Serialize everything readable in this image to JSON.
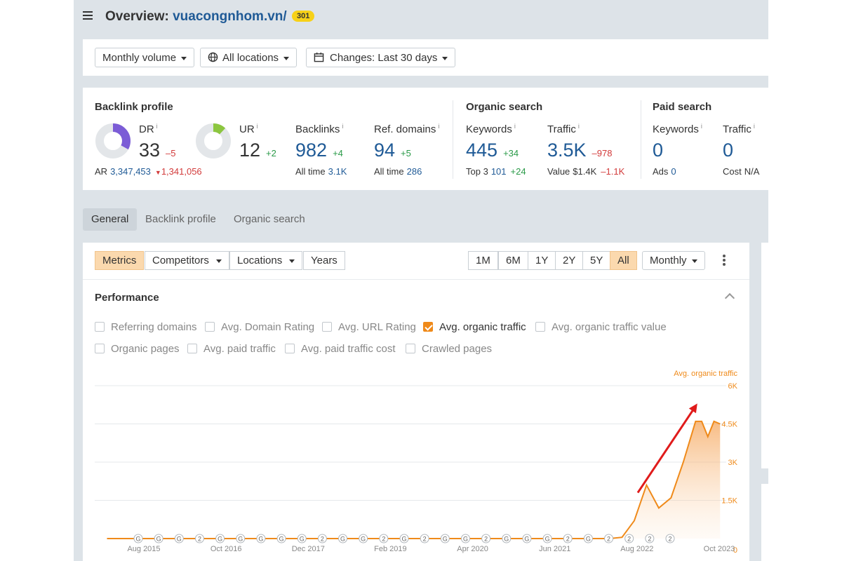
{
  "header": {
    "title_prefix": "Overview:",
    "domain": "vuacongnhom.vn/",
    "badge": "301"
  },
  "filters": {
    "volume": "Monthly volume",
    "locations": "All locations",
    "changes": "Changes: Last 30 days"
  },
  "backlink_profile": {
    "heading": "Backlink profile",
    "dr": {
      "label": "DR",
      "value": "33",
      "delta": "–5",
      "ring_fraction": 0.33,
      "ring_color": "#7b5cd6"
    },
    "ur": {
      "label": "UR",
      "value": "12",
      "delta": "+2",
      "ring_fraction": 0.12,
      "ring_color": "#8cc63f"
    },
    "ar": {
      "label": "AR",
      "value": "3,347,453",
      "delta": "1,341,056"
    },
    "backlinks": {
      "label": "Backlinks",
      "value": "982",
      "delta": "+4",
      "sub_label": "All time",
      "sub_value": "3.1K"
    },
    "ref_domains": {
      "label": "Ref. domains",
      "value": "94",
      "delta": "+5",
      "sub_label": "All time",
      "sub_value": "286"
    }
  },
  "organic_search": {
    "heading": "Organic search",
    "keywords": {
      "label": "Keywords",
      "value": "445",
      "delta": "+34",
      "sub_label": "Top 3",
      "sub_value": "101",
      "sub_delta": "+24"
    },
    "traffic": {
      "label": "Traffic",
      "value": "3.5K",
      "delta": "–978",
      "sub_label": "Value",
      "sub_value": "$1.4K",
      "sub_delta": "–1.1K"
    }
  },
  "paid_search": {
    "heading": "Paid search",
    "keywords": {
      "label": "Keywords",
      "value": "0",
      "sub_label": "Ads",
      "sub_value": "0"
    },
    "traffic": {
      "label": "Traffic",
      "value": "0",
      "sub_label": "Cost",
      "sub_value": "N/A"
    }
  },
  "tabs": [
    "General",
    "Backlink profile",
    "Organic search"
  ],
  "toolbar": {
    "metrics": "Metrics",
    "competitors": "Competitors",
    "locations": "Locations",
    "years": "Years",
    "ranges": [
      "1M",
      "6M",
      "1Y",
      "2Y",
      "5Y",
      "All"
    ],
    "active_range": "All",
    "interval": "Monthly"
  },
  "performance": {
    "title": "Performance",
    "checkboxes": [
      {
        "label": "Referring domains",
        "checked": false
      },
      {
        "label": "Avg. Domain Rating",
        "checked": false
      },
      {
        "label": "Avg. URL Rating",
        "checked": false
      },
      {
        "label": "Avg. organic traffic",
        "checked": true
      },
      {
        "label": "Avg. organic traffic value",
        "checked": false
      },
      {
        "label": "Organic pages",
        "checked": false
      },
      {
        "label": "Avg. paid traffic",
        "checked": false
      },
      {
        "label": "Avg. paid traffic cost",
        "checked": false
      },
      {
        "label": "Crawled pages",
        "checked": false
      }
    ]
  },
  "colors": {
    "accent": "#ef8a1a",
    "link": "#1f5a96",
    "positive": "#2a9a48",
    "negative": "#d23a3a",
    "annotation": "#e01b1b"
  },
  "chart_data": {
    "type": "area",
    "series_label": "Avg. organic traffic",
    "x": [
      "2015-08",
      "2016-02",
      "2016-10",
      "2017-06",
      "2017-12",
      "2018-06",
      "2019-02",
      "2019-10",
      "2020-04",
      "2020-10",
      "2021-06",
      "2021-12",
      "2022-06",
      "2022-08",
      "2022-10",
      "2022-12",
      "2023-02",
      "2023-04",
      "2023-06",
      "2023-08",
      "2023-09",
      "2023-10",
      "2023-11",
      "2023-12"
    ],
    "y": [
      0,
      0,
      0,
      0,
      0,
      0,
      0,
      0,
      0,
      0,
      0,
      0,
      0,
      50,
      700,
      2100,
      1200,
      1600,
      3000,
      4600,
      4600,
      4000,
      4600,
      4500
    ],
    "x_ticks": [
      "Aug 2015",
      "Oct 2016",
      "Dec 2017",
      "Feb 2019",
      "Apr 2020",
      "Jun 2021",
      "Aug 2022",
      "Oct 2023"
    ],
    "y_ticks": [
      "0",
      "1.5K",
      "3K",
      "4.5K",
      "6K"
    ],
    "ylim": [
      0,
      6000
    ],
    "grid": true,
    "annotations": [
      "G",
      "G",
      "G",
      "2",
      "G",
      "G",
      "G",
      "G",
      "G",
      "2",
      "G",
      "G",
      "2",
      "G",
      "2",
      "G",
      "G",
      "2",
      "G",
      "G",
      "G",
      "2",
      "G",
      "2",
      "2",
      "2",
      "2"
    ]
  }
}
